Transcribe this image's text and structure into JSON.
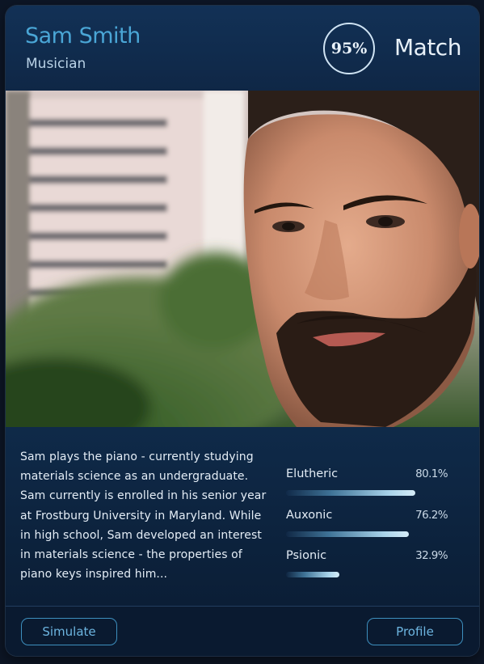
{
  "profile": {
    "name": "Sam Smith",
    "role": "Musician",
    "match_percent": "95%",
    "match_label": "Match",
    "bio": "Sam plays the piano - currently studying materials science as an undergraduate. Sam currently is enrolled in his senior year at Frostburg University in Maryland. While in high school, Sam developed an interest in materials science - the properties of piano keys inspired him..."
  },
  "stats": [
    {
      "label": "Elutheric",
      "value": "80.1%",
      "level": 0.801
    },
    {
      "label": "Auxonic",
      "value": "76.2%",
      "level": 0.762
    },
    {
      "label": "Psionic",
      "value": "32.9%",
      "level": 0.329
    }
  ],
  "actions": {
    "simulate_label": "Simulate",
    "profile_label": "Profile"
  },
  "colors": {
    "name": "#4aa6d6",
    "button_border": "#3d8fbe",
    "card_bg": "#0f2744"
  }
}
